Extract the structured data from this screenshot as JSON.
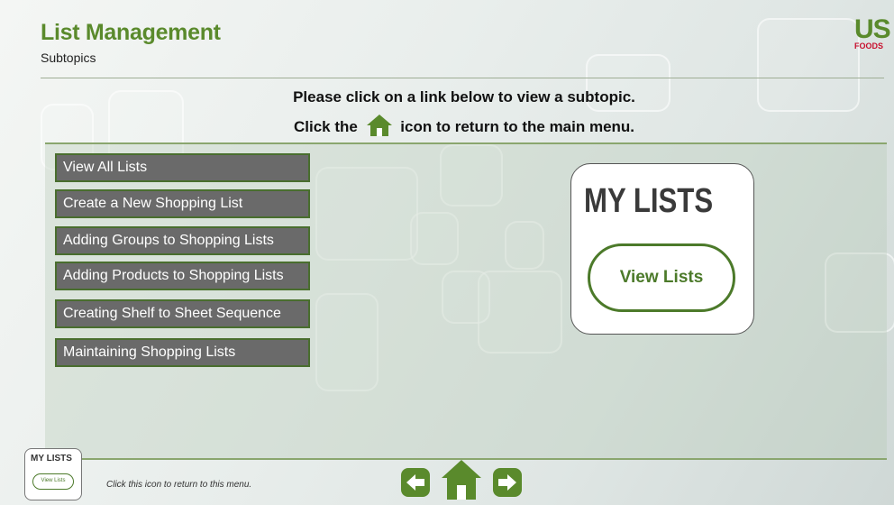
{
  "header": {
    "title": "List Management",
    "subtitle": "Subtopics",
    "logo": {
      "top": "US",
      "bottom": "FOODS",
      "color_top": "#5a8a2c",
      "color_bottom": "#c8102e"
    }
  },
  "instructions": {
    "line1": "Please click on a link below to view a subtopic.",
    "line2_before": "Click the",
    "line2_after": "icon to return to the main menu.",
    "icon": "home-icon"
  },
  "links": [
    {
      "label": "View All Lists"
    },
    {
      "label": "Create a New Shopping List"
    },
    {
      "label": "Adding Groups to Shopping Lists"
    },
    {
      "label": "Adding Products to Shopping Lists"
    },
    {
      "label": "Creating Shelf to Sheet Sequence"
    },
    {
      "label": "Maintaining Shopping Lists"
    }
  ],
  "card": {
    "title": "MY LISTS",
    "button_label": "View Lists"
  },
  "footer": {
    "thumb_title": "MY LISTS",
    "thumb_button": "View Lists",
    "note": "Click this icon to return to this menu.",
    "nav": [
      "back-arrow-icon",
      "home-icon",
      "forward-arrow-icon"
    ]
  },
  "colors": {
    "brand_green": "#5a8a2c",
    "button_grey": "#6a6a6a",
    "button_border": "#496e2e",
    "card_green": "#4c7a2a"
  }
}
